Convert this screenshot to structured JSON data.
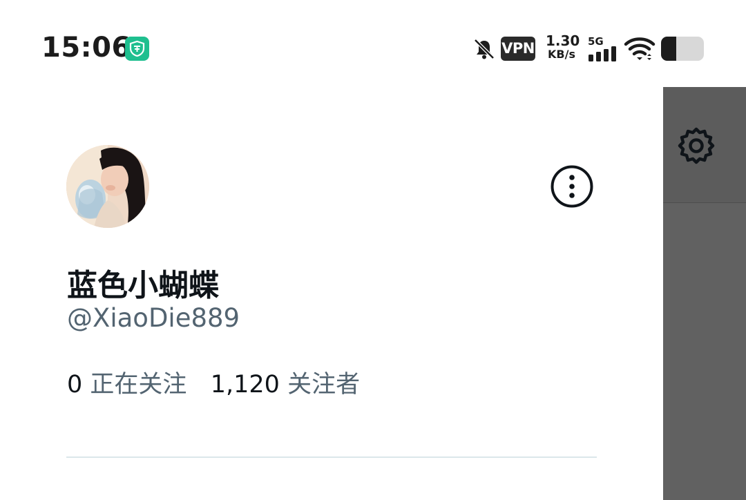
{
  "status_bar": {
    "time": "15:06",
    "app_badge_icon": "shield-app-icon",
    "vpn_label": "VPN",
    "speed_value": "1.30",
    "speed_unit": "KB/s",
    "network_type": "5G",
    "battery_level": 0.35,
    "colors": {
      "app_badge": "#1fbf8f"
    }
  },
  "side_panel": {
    "icon": "gear-icon",
    "background": "#616161"
  },
  "profile": {
    "display_name": "蓝色小蝴蝶",
    "handle": "@XiaoDie889",
    "following_count": "0",
    "following_label": "正在关注",
    "followers_count": "1,120",
    "followers_label": "关注者",
    "more_icon": "more-options-icon"
  },
  "colors": {
    "text_primary": "#0f1419",
    "text_secondary": "#536471",
    "divider": "#dbe7ea"
  }
}
